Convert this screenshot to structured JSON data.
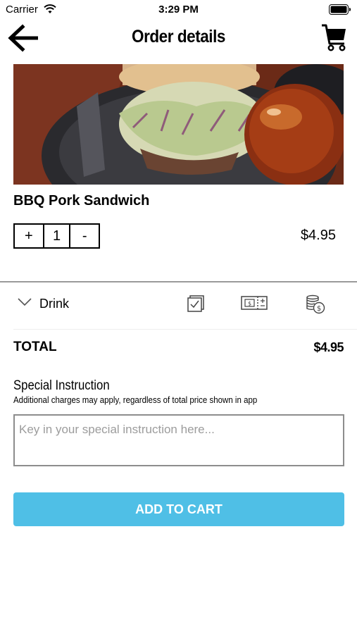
{
  "status_bar": {
    "carrier": "Carrier",
    "time": "3:29 PM"
  },
  "nav": {
    "title": "Order details"
  },
  "product": {
    "name": "BBQ Pork Sandwich",
    "price": "$4.95",
    "quantity": "1",
    "plus_label": "+",
    "minus_label": "-"
  },
  "options": {
    "label": "Drink"
  },
  "total": {
    "label": "TOTAL",
    "value": "$4.95"
  },
  "special_instruction": {
    "title": "Special Instruction",
    "note": "Additional charges may apply, regardless of total price shown in app",
    "placeholder": "Key in your special instruction here...",
    "value": ""
  },
  "add_to_cart_label": "ADD TO CART",
  "colors": {
    "accent": "#4fbfe6",
    "divider": "#9a9a9a"
  }
}
